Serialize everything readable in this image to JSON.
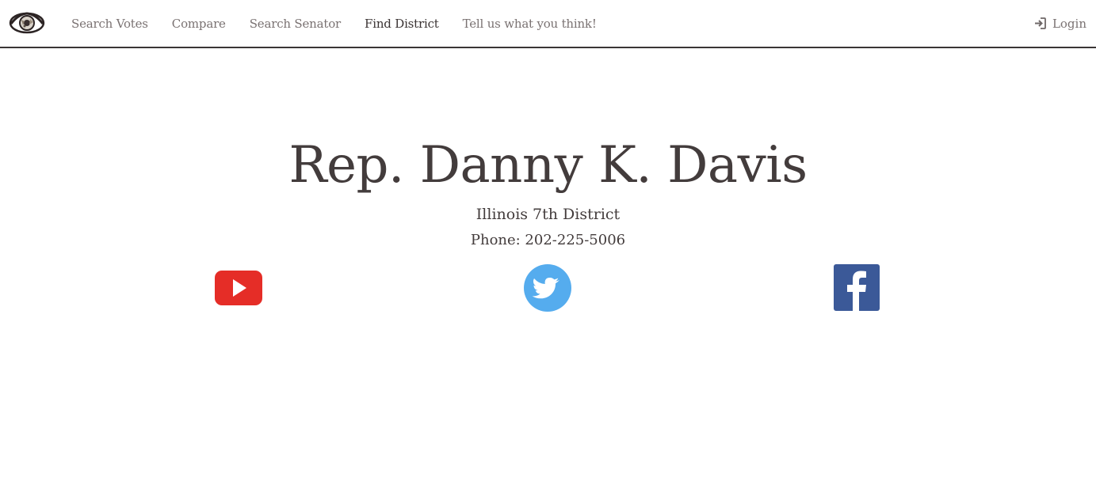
{
  "nav": {
    "links": [
      {
        "label": "Search Votes"
      },
      {
        "label": "Compare"
      },
      {
        "label": "Search Senator"
      },
      {
        "label": "Find District"
      },
      {
        "label": "Tell us what you think!"
      }
    ],
    "active": "Find District",
    "login_label": "Login",
    "logo_icon": "eye-logo-icon",
    "login_icon": "sign-in-icon"
  },
  "rep": {
    "name": "Rep. Danny K. Davis",
    "district": "Illinois 7th District",
    "phone": "Phone: 202-225-5006"
  },
  "social": {
    "youtube": {
      "icon": "youtube-icon",
      "color": "#e52d27"
    },
    "twitter": {
      "icon": "twitter-icon",
      "color": "#55acee"
    },
    "facebook": {
      "icon": "facebook-icon",
      "color": "#3b5998"
    }
  },
  "colors": {
    "text": "#433c3c",
    "nav_text": "#7a7272",
    "nav_active": "#3a3333",
    "nav_border": "#3a3535"
  }
}
